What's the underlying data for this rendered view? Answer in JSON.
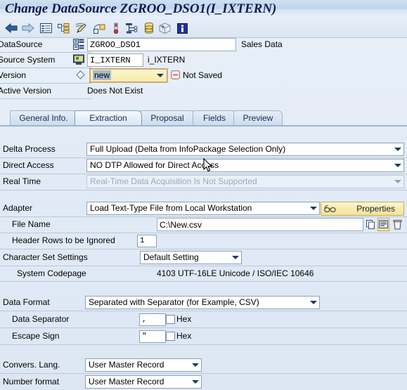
{
  "window": {
    "title": "Change DataSource ZGROO_DSO1(I_IXTERN)"
  },
  "toolbar": {
    "icons": [
      {
        "name": "back-icon",
        "label": "Back"
      },
      {
        "name": "forward-icon",
        "label": "Forward"
      },
      {
        "name": "list-icon",
        "label": "List"
      },
      {
        "name": "hierarchy-icon",
        "label": "Hierarchy"
      },
      {
        "name": "edit-pencil-icon",
        "label": "Edit"
      },
      {
        "name": "shapes-icon",
        "label": "Objects"
      },
      {
        "name": "thermometer-icon",
        "label": "Check"
      },
      {
        "name": "tree-structure-icon",
        "label": "Structure"
      },
      {
        "name": "database-icon",
        "label": "Database"
      },
      {
        "name": "cube-icon",
        "label": "InfoCube"
      },
      {
        "name": "info-icon",
        "label": "Information"
      }
    ]
  },
  "header": {
    "datasource": {
      "label": "DataSource",
      "value": "ZGROO_DSO1",
      "description": "Sales Data",
      "icon": "datasource-icon"
    },
    "source_system": {
      "label": "Source System",
      "value": "I_IXTERN",
      "description": "i_IXTERN",
      "icon": "source-system-icon"
    },
    "version": {
      "label": "Version",
      "value": "new",
      "status": "Not Saved",
      "icon": "diamond-icon",
      "status_icon": "minus-circle-icon"
    },
    "active_version": {
      "label": "Active Version",
      "value": "Does Not Exist"
    }
  },
  "tabs": [
    {
      "label": "General Info.",
      "active": false
    },
    {
      "label": "Extraction",
      "active": true
    },
    {
      "label": "Proposal",
      "active": false
    },
    {
      "label": "Fields",
      "active": false
    },
    {
      "label": "Preview",
      "active": false
    }
  ],
  "extraction": {
    "delta_process": {
      "label": "Delta Process",
      "value": "Full Upload (Delta from InfoPackage Selection Only)",
      "disabled": false
    },
    "direct_access": {
      "label": "Direct Access",
      "value": "NO DTP Allowed for Direct Access",
      "disabled": false
    },
    "real_time": {
      "label": "Real Time",
      "value": "Real-Time Data Acquisition Is Not Supported",
      "disabled": true
    },
    "adapter": {
      "label": "Adapter",
      "value": "Load Text-Type File from Local Workstation",
      "properties_button": "Properties",
      "properties_icon": "glasses-icon"
    },
    "file_name": {
      "label": "File Name",
      "value": "C:\\New.csv",
      "icons": [
        {
          "name": "copy-icon",
          "focused": false
        },
        {
          "name": "select-list-icon",
          "focused": true
        },
        {
          "name": "delete-trash-icon",
          "focused": false
        }
      ]
    },
    "header_rows": {
      "label": "Header Rows to be Ignored",
      "value": "1"
    },
    "character_set": {
      "label": "Character Set Settings",
      "value": "Default Setting"
    },
    "system_codepage": {
      "label": "System Codepage",
      "value": "4103  UTF-16LE Unicode / ISO/IEC 10646"
    },
    "data_format": {
      "label": "Data Format",
      "value": "Separated with Separator (for Example, CSV)"
    },
    "data_separator": {
      "label": "Data Separator",
      "value": ",",
      "hex_label": "Hex",
      "hex_checked": false
    },
    "escape_sign": {
      "label": "Escape Sign",
      "value": "\"",
      "hex_label": "Hex",
      "hex_checked": false
    },
    "convers_lang": {
      "label": "Convers. Lang.",
      "value": "User Master Record"
    },
    "number_format": {
      "label": "Number format",
      "value": "User Master Record"
    }
  },
  "colors": {
    "title_text": "#121a4e",
    "panel_bg": "#dde7f4",
    "accent_yellow": "#f7ebae",
    "focus_orange": "#d79b43",
    "tab_active_bg": "#e9f2fc"
  }
}
